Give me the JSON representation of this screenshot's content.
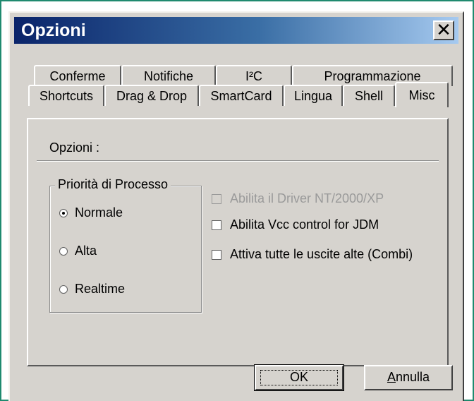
{
  "window": {
    "title": "Opzioni",
    "close_glyph": "✕"
  },
  "tabs_row_back": [
    {
      "label": "Conferme"
    },
    {
      "label": "Notifiche"
    },
    {
      "label": "I²C"
    },
    {
      "label": "Programmazione"
    }
  ],
  "tabs_row_front": [
    {
      "label": "Shortcuts"
    },
    {
      "label": "Drag & Drop"
    },
    {
      "label": "SmartCard"
    },
    {
      "label": "Lingua"
    },
    {
      "label": "Shell"
    },
    {
      "label": "Misc",
      "active": true
    }
  ],
  "panel": {
    "section_label": "Opzioni :",
    "priority_group": {
      "legend": "Priorità di Processo",
      "options": [
        {
          "label": "Normale",
          "checked": true
        },
        {
          "label": "Alta",
          "checked": false
        },
        {
          "label": "Realtime",
          "checked": false
        }
      ]
    },
    "checkboxes": [
      {
        "label": "Abilita il Driver NT/2000/XP",
        "checked": false,
        "enabled": false
      },
      {
        "label": "Abilita Vcc control for JDM",
        "checked": false,
        "enabled": true
      },
      {
        "label": "Attiva tutte le uscite alte (Combi)",
        "checked": false,
        "enabled": true
      }
    ]
  },
  "buttons": {
    "ok": "OK",
    "cancel_first": "A",
    "cancel_rest": "nnulla"
  },
  "colors": {
    "frame_border": "#1f8a6f",
    "dialog_face": "#d6d3ce",
    "title_start": "#0a246a",
    "title_end": "#a6caf0"
  }
}
